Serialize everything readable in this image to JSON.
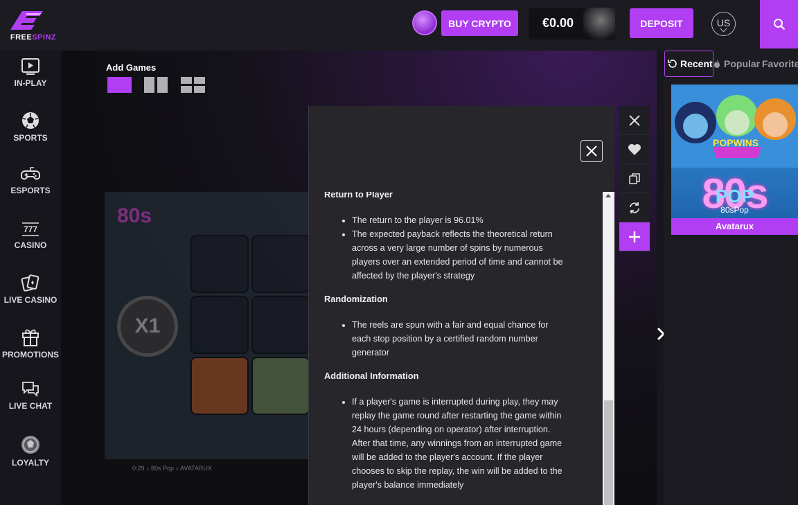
{
  "header": {
    "logo": {
      "part1": "FREE",
      "part2": "SPINZ"
    },
    "buy_crypto_label": "BUY CRYPTO",
    "balance": "€0.00",
    "deposit_label": "DEPOSIT",
    "language": "US"
  },
  "sidebar": {
    "items": [
      {
        "label": "IN-PLAY",
        "icon": "in-play-icon"
      },
      {
        "label": "SPORTS",
        "icon": "soccer-ball-icon"
      },
      {
        "label": "ESPORTS",
        "icon": "gamepad-icon"
      },
      {
        "label": "CASINO",
        "icon": "slot-777-icon"
      },
      {
        "label": "LIVE CASINO",
        "icon": "cards-icon"
      },
      {
        "label": "PROMOTIONS",
        "icon": "gift-icon"
      },
      {
        "label": "LIVE CHAT",
        "icon": "chat-icon"
      },
      {
        "label": "LOYALTY",
        "icon": "loyalty-badge-icon"
      }
    ]
  },
  "main": {
    "add_games_label": "Add Games",
    "frame": {
      "logo": "80s",
      "multiplier": "X1",
      "footer": "0:29  ♪ 80s Pop ♪   AVATARUX"
    }
  },
  "modal": {
    "sections": [
      {
        "heading": "Return to Player",
        "items": [
          "The return to the player is 96.01%",
          "The expected payback reflects the theoretical return across a very large number of spins by numerous players over an extended period of time and cannot be affected by the player's strategy"
        ]
      },
      {
        "heading": "Randomization",
        "items": [
          "The reels are spun with a fair and equal chance for each stop position by a certified random number generator"
        ]
      },
      {
        "heading": "Additional Information",
        "items": [
          "If a player's game is interrupted during play, they may replay the game round after restarting the game within 24 hours (depending on operator) after interruption. After that time, any winnings from an interrupted game will be added to the player's account. If the player chooses to skip the replay, the win will be added to the player's balance immediately"
        ]
      }
    ]
  },
  "right_panel": {
    "tabs": [
      {
        "label": "Recent",
        "icon": "refresh-icon"
      },
      {
        "label": "Popular",
        "icon": "flame-icon"
      },
      {
        "label": "Favorites",
        "icon": "star-icon"
      }
    ],
    "card": {
      "brand": "POPWINS",
      "title": "80s",
      "subtitle": "POP",
      "name": "80sPop",
      "provider": "Avatarux"
    }
  },
  "colors": {
    "accent": "#b13ef2",
    "background": "#16161c",
    "modal": "#27272b"
  }
}
